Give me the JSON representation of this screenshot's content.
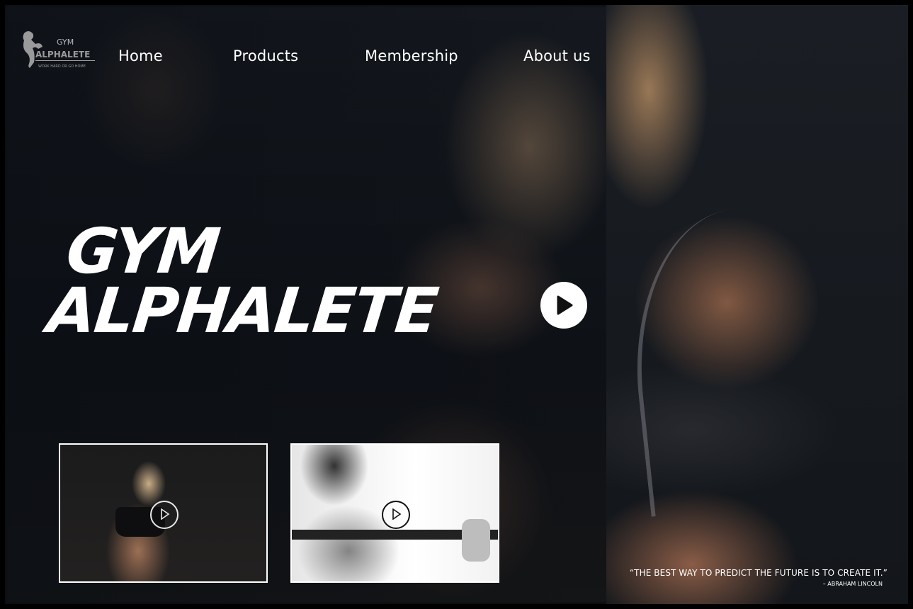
{
  "brand": {
    "logo_main": "GYM",
    "logo_sub": "ALPHALETE",
    "logo_tagline": "WORK HARD OR GO HOME"
  },
  "nav": {
    "items": [
      {
        "label": "Home"
      },
      {
        "label": "Products"
      },
      {
        "label": "Membership"
      },
      {
        "label": "About us"
      }
    ]
  },
  "hero": {
    "title_line1": "GYM",
    "title_line2": "ALPHALETE"
  },
  "quote": {
    "text": "“THE BEST WAY TO PREDICT THE FUTURE IS TO CREATE IT.”",
    "author": "– ABRAHAM LINCOLN"
  },
  "icons": {
    "play": "play-icon",
    "logo": "bodybuilder-icon"
  },
  "colors": {
    "text": "#ffffff",
    "background": "#0e1116"
  }
}
